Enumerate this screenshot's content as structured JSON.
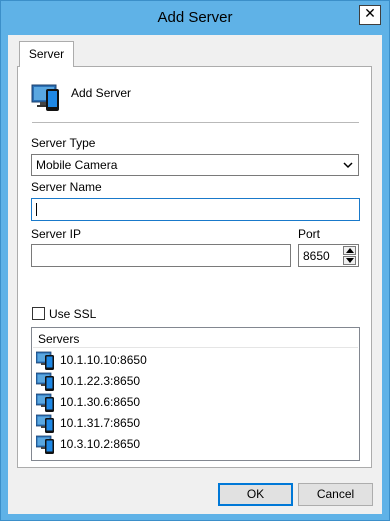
{
  "window": {
    "title": "Add Server",
    "close_glyph": "✕"
  },
  "tab": {
    "label": "Server"
  },
  "header": {
    "label": "Add Server",
    "icon": "monitor-phone-icon"
  },
  "server_type": {
    "label": "Server Type",
    "value": "Mobile Camera"
  },
  "server_name": {
    "label": "Server Name",
    "value": ""
  },
  "server_ip": {
    "label": "Server IP",
    "value": ""
  },
  "port": {
    "label": "Port",
    "value": "8650"
  },
  "ssl": {
    "label": "Use SSL",
    "checked": false
  },
  "servers": {
    "header": "Servers",
    "items": [
      "10.1.10.10:8650",
      "10.1.22.3:8650",
      "10.1.30.6:8650",
      "10.1.31.7:8650",
      "10.3.10.2:8650"
    ]
  },
  "buttons": {
    "ok": "OK",
    "cancel": "Cancel"
  },
  "colors": {
    "titlebar": "#5fb2e7",
    "accent": "#0078d7"
  }
}
